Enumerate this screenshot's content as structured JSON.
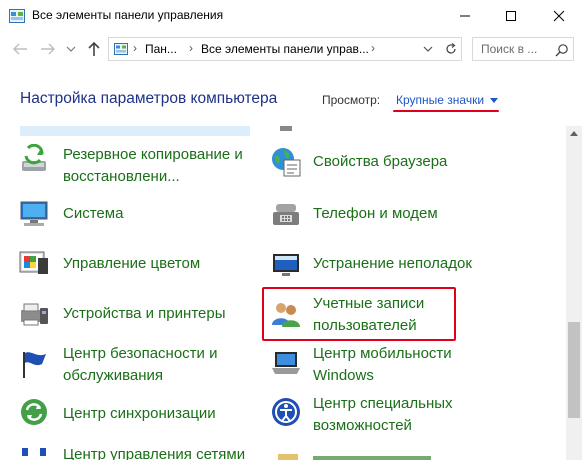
{
  "window": {
    "title": "Все элементы панели управления",
    "controls": {
      "minimize": "—",
      "maximize": "☐",
      "close": "✕"
    }
  },
  "nav": {
    "back_icon": "arrow-left-icon",
    "forward_icon": "arrow-right-icon",
    "recent_icon": "chevron-down-icon",
    "up_icon": "arrow-up-icon"
  },
  "address": {
    "segments": [
      "Пан...",
      "Все элементы панели управ..."
    ],
    "separator": "›",
    "drop_icon": "chevron-down-icon",
    "refresh_icon": "refresh-icon"
  },
  "search": {
    "placeholder": "Поиск в ..."
  },
  "header": {
    "title": "Настройка параметров компьютера",
    "view_label": "Просмотр:",
    "view_value": "Крупные значки"
  },
  "items_left": [
    {
      "label1": "Резервное копирование и",
      "label2": "восстановлени...",
      "icon": "backup-icon"
    },
    {
      "label1": "Система",
      "label2": "",
      "icon": "system-icon"
    },
    {
      "label1": "Управление цветом",
      "label2": "",
      "icon": "color-management-icon"
    },
    {
      "label1": "Устройства и принтеры",
      "label2": "",
      "icon": "printer-icon"
    },
    {
      "label1": "Центр безопасности и",
      "label2": "обслуживания",
      "icon": "flag-icon"
    },
    {
      "label1": "Центр синхронизации",
      "label2": "",
      "icon": "sync-icon"
    },
    {
      "label1": "Центр управления сетями",
      "label2": "",
      "icon": "network-icon"
    }
  ],
  "items_right": [
    {
      "label1": "Свойства браузера",
      "label2": "",
      "icon": "internet-options-icon"
    },
    {
      "label1": "Телефон и модем",
      "label2": "",
      "icon": "phone-modem-icon"
    },
    {
      "label1": "Устранение неполадок",
      "label2": "",
      "icon": "troubleshooting-icon"
    },
    {
      "label1": "Учетные записи",
      "label2": "пользователей",
      "icon": "user-accounts-icon"
    },
    {
      "label1": "Центр мобильности",
      "label2": "Windows",
      "icon": "mobility-center-icon"
    },
    {
      "label1": "Центр специальных",
      "label2": "возможностей",
      "icon": "accessibility-icon"
    }
  ],
  "colors": {
    "link_green": "#1a6f18",
    "title_blue": "#1e3287",
    "highlight_red": "#e0001b"
  }
}
